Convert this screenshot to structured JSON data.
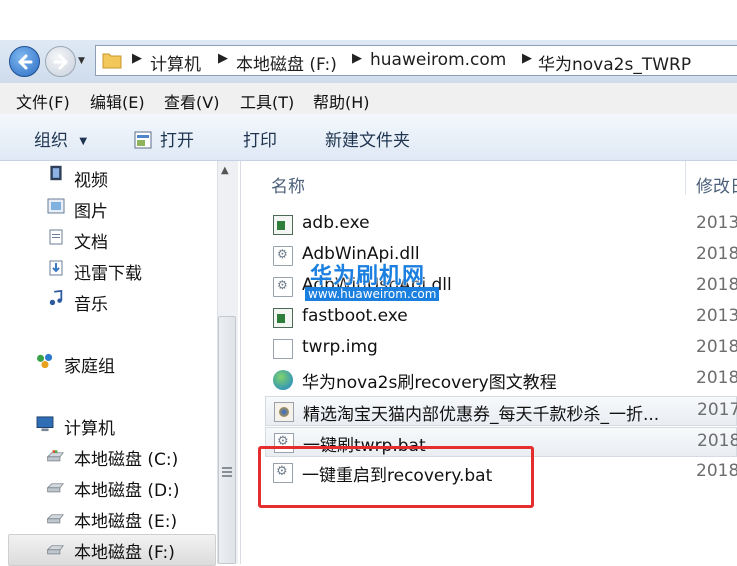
{
  "address": {
    "crumbs": [
      "计算机",
      "本地磁盘 (F:)",
      "huaweirom.com",
      "华为nova2s_TWRP"
    ]
  },
  "menu": [
    "文件(F)",
    "编辑(E)",
    "查看(V)",
    "工具(T)",
    "帮助(H)"
  ],
  "toolbar": {
    "organize": "组织",
    "open": "打开",
    "print": "打印",
    "new_folder": "新建文件夹"
  },
  "nav": {
    "libraries": [
      "视频",
      "图片",
      "文档",
      "迅雷下载",
      "音乐"
    ],
    "homegroup": "家庭组",
    "computer": "计算机",
    "drives": [
      "本地磁盘 (C:)",
      "本地磁盘 (D:)",
      "本地磁盘 (E:)",
      "本地磁盘 (F:)"
    ],
    "selected": "本地磁盘 (F:)"
  },
  "columns": {
    "name": "名称",
    "modified": "修改日"
  },
  "files": [
    {
      "name": "adb.exe",
      "date": "2013",
      "icon": "exe-icon"
    },
    {
      "name": "AdbWinApi.dll",
      "date": "2018",
      "icon": "dll-icon"
    },
    {
      "name": "AdbWinUsbApi.dll",
      "date": "2018",
      "icon": "dll-icon"
    },
    {
      "name": "fastboot.exe",
      "date": "2013",
      "icon": "exe-icon"
    },
    {
      "name": "twrp.img",
      "date": "2018",
      "icon": "img-icon"
    },
    {
      "name": "华为nova2s刷recovery图文教程",
      "date": "2018",
      "icon": "globe-icon"
    },
    {
      "name": "精选淘宝天猫内部优惠券_每天千款秒杀_一折...",
      "date": "2017",
      "icon": "url-icon"
    },
    {
      "name": "一键刷twrp.bat",
      "date": "2018",
      "icon": "bat-icon"
    },
    {
      "name": "一键重启到recovery.bat",
      "date": "2018",
      "icon": "bat-icon"
    }
  ],
  "watermark": {
    "title": "华为刷机网",
    "url": "www.huaweirom.com"
  },
  "colors": {
    "highlight_box": "#e52d2d",
    "watermark": "#1b7fe0"
  }
}
